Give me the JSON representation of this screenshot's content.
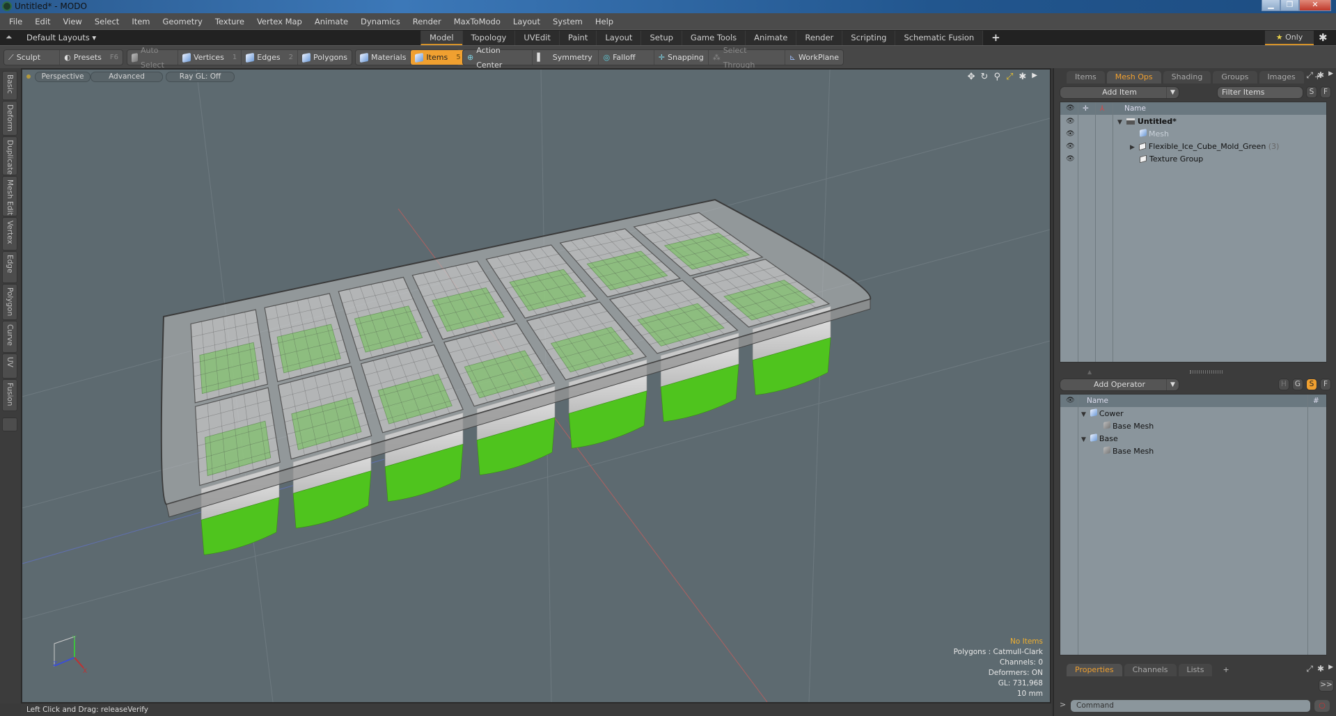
{
  "window": {
    "title": "Untitled* - MODO",
    "controls": [
      "minimize",
      "restore",
      "close"
    ]
  },
  "menu": [
    "File",
    "Edit",
    "View",
    "Select",
    "Item",
    "Geometry",
    "Texture",
    "Vertex Map",
    "Animate",
    "Dynamics",
    "Render",
    "MaxToModo",
    "Layout",
    "System",
    "Help"
  ],
  "layout_bar": {
    "layouts_label": "Default Layouts ▾",
    "tabs": [
      "Model",
      "Topology",
      "UVEdit",
      "Paint",
      "Layout",
      "Setup",
      "Game Tools",
      "Animate",
      "Render",
      "Scripting",
      "Schematic Fusion"
    ],
    "active_tab": "Model",
    "add_tab": "+",
    "only_label": "Only"
  },
  "toolbar": {
    "sculpt": "Sculpt",
    "presets": "Presets",
    "presets_key": "F6",
    "auto_select": "Auto Select",
    "vertices": "Vertices",
    "vertices_key": "1",
    "edges": "Edges",
    "edges_key": "2",
    "polygons": "Polygons",
    "materials": "Materials",
    "items": "Items",
    "items_key": "5",
    "action_center": "Action Center",
    "symmetry": "Symmetry",
    "falloff": "Falloff",
    "snapping": "Snapping",
    "select_through": "Select Through",
    "workplane": "WorkPlane"
  },
  "left_tabs": [
    "Basic",
    "Deform",
    "Duplicate",
    "Mesh Edit",
    "Vertex",
    "Edge",
    "Polygon",
    "Curve",
    "UV",
    "Fusion"
  ],
  "viewport": {
    "view_mode": "Perspective",
    "shading": "Advanced",
    "raygl": "Ray GL: Off",
    "info": {
      "selection": "No Items",
      "polygons": "Polygons : Catmull-Clark",
      "channels": "Channels: 0",
      "deformers": "Deformers: ON",
      "gl": "GL: 731,968",
      "unit": "10 mm"
    },
    "axis_labels": {
      "x": "X",
      "y": "Y",
      "z": "Z"
    }
  },
  "status_bar": "Left Click and Drag:   releaseVerify",
  "right_panel": {
    "top_tabs": [
      "Items",
      "Mesh Ops",
      "Shading",
      "Groups",
      "Images"
    ],
    "top_active": "Mesh Ops",
    "add_item": "Add Item",
    "filter_placeholder": "Filter Items",
    "s_btn": "S",
    "f_btn": "F",
    "name_header": "Name",
    "tree": [
      {
        "label": "Untitled*",
        "bold": true,
        "expanded": true
      },
      {
        "label": "Mesh",
        "dim": true
      },
      {
        "label": "Flexible_Ice_Cube_Mold_Green",
        "count": "(3)"
      },
      {
        "label": "Texture Group"
      }
    ],
    "add_operator": "Add Operator",
    "op_buttons": [
      "H",
      "G",
      "S",
      "F"
    ],
    "op_header_name": "Name",
    "op_header_count": "#",
    "operators": [
      {
        "label": "Cower",
        "children": [
          "Base Mesh"
        ]
      },
      {
        "label": "Base",
        "children": [
          "Base Mesh"
        ]
      }
    ],
    "bottom_tabs": [
      "Properties",
      "Channels",
      "Lists"
    ],
    "bottom_active": "Properties",
    "expand_btn": ">>",
    "command_placeholder": "Command"
  },
  "colors": {
    "accent": "#f0a030",
    "viewport_bg": "#5d6a70",
    "mold_green": "#4fc41e"
  }
}
